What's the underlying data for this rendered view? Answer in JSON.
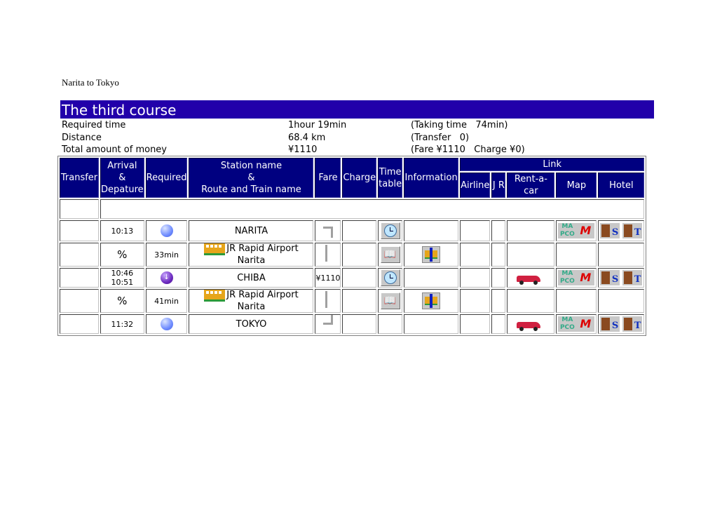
{
  "page_title": "Narita to Tokyo",
  "course_title": "The third course",
  "colors": {
    "course_bar": "#2200aa",
    "table_header": "#000080"
  },
  "summary": [
    {
      "label": "Required time",
      "value": "1hour 19min",
      "extra": "(Taking time   74min)"
    },
    {
      "label": "Distance",
      "value": "68.4 km",
      "extra": "(Transfer   0)"
    },
    {
      "label": "Total amount of money",
      "value": "¥1110",
      "extra": "(Fare ¥1110   Charge ¥0)"
    }
  ],
  "table": {
    "headers": {
      "transfer": "Transfer",
      "arrival_1": "Arrival",
      "arrival_2": "&",
      "arrival_3": "Depature",
      "required": "Required",
      "station_1": "Station name",
      "station_2": "&",
      "station_3": "Route and Train name",
      "fare": "Fare",
      "charge": "Charge",
      "timetable_1": "Time",
      "timetable_2": "table",
      "information": "Information",
      "link": "Link",
      "airline": "Airline",
      "jr": "J R",
      "rentacar": "Rent-a-car",
      "map": "Map",
      "hotel": "Hotel"
    },
    "rows": [
      {
        "type": "station",
        "time": "10:13",
        "time2": "",
        "marker": "blue-dot",
        "name": "NARITA",
        "fare": "",
        "timetable_icon": "clock-icon",
        "rentacar": false,
        "map": true,
        "hotel": true
      },
      {
        "type": "route",
        "transfer_sym": "%",
        "required": "33min",
        "name": "JR Rapid Airport Narita",
        "timetable_icon": "timetable-book-icon",
        "info_icon": "train-info-icon"
      },
      {
        "type": "station",
        "time": "10:46",
        "time2": "10:51",
        "marker": "purple-down-dot",
        "name": "CHIBA",
        "fare": "¥1110",
        "timetable_icon": "clock-icon",
        "rentacar": true,
        "map": true,
        "hotel": true
      },
      {
        "type": "route",
        "transfer_sym": "%",
        "required": "41min",
        "name": "JR Rapid Airport Narita",
        "timetable_icon": "timetable-book-icon",
        "info_icon": "train-info-icon"
      },
      {
        "type": "station",
        "time": "11:32",
        "time2": "",
        "marker": "blue-dot",
        "name": "TOKYO",
        "fare": "",
        "timetable_icon": "",
        "rentacar": true,
        "map": true,
        "hotel": true
      }
    ],
    "map_icons": [
      "MAPCO",
      "M"
    ],
    "hotel_icons": [
      "S",
      "T"
    ]
  }
}
